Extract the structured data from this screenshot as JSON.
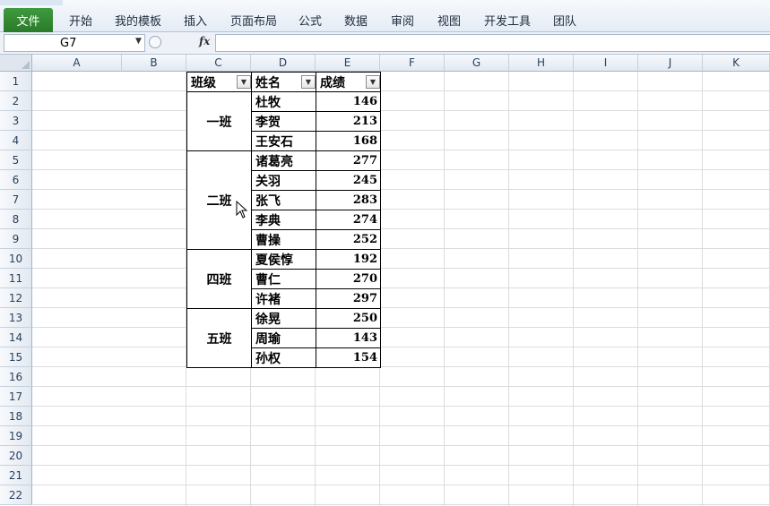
{
  "ribbon": {
    "file_tab": "文件",
    "tabs": [
      "开始",
      "我的模板",
      "插入",
      "页面布局",
      "公式",
      "数据",
      "审阅",
      "视图",
      "开发工具",
      "团队"
    ]
  },
  "formula_bar": {
    "name_box": "G7",
    "fx_label": "fx",
    "formula": ""
  },
  "columns": [
    "A",
    "B",
    "C",
    "D",
    "E",
    "F",
    "G",
    "H",
    "I",
    "J",
    "K"
  ],
  "rows": [
    "1",
    "2",
    "3",
    "4",
    "5",
    "6",
    "7",
    "8",
    "9",
    "10",
    "11",
    "12",
    "13",
    "14",
    "15",
    "16",
    "17",
    "18",
    "19",
    "20",
    "21",
    "22"
  ],
  "table": {
    "headers": [
      "班级",
      "姓名",
      "成绩"
    ],
    "groups": [
      {
        "class": "一班",
        "students": [
          {
            "name": "杜牧",
            "score": "146"
          },
          {
            "name": "李贺",
            "score": "213"
          },
          {
            "name": "王安石",
            "score": "168"
          }
        ]
      },
      {
        "class": "二班",
        "students": [
          {
            "name": "诸葛亮",
            "score": "277"
          },
          {
            "name": "关羽",
            "score": "245"
          },
          {
            "name": "张飞",
            "score": "283"
          },
          {
            "name": "李典",
            "score": "274"
          },
          {
            "name": "曹操",
            "score": "252"
          }
        ]
      },
      {
        "class": "四班",
        "students": [
          {
            "name": "夏侯惇",
            "score": "192"
          },
          {
            "name": "曹仁",
            "score": "270"
          },
          {
            "name": "许褚",
            "score": "297"
          }
        ]
      },
      {
        "class": "五班",
        "students": [
          {
            "name": "徐晃",
            "score": "250"
          },
          {
            "name": "周瑜",
            "score": "143"
          },
          {
            "name": "孙权",
            "score": "154"
          }
        ]
      }
    ]
  },
  "icons": {
    "filter": "filter-dropdown-icon",
    "cursor": "mouse-pointer-icon"
  }
}
